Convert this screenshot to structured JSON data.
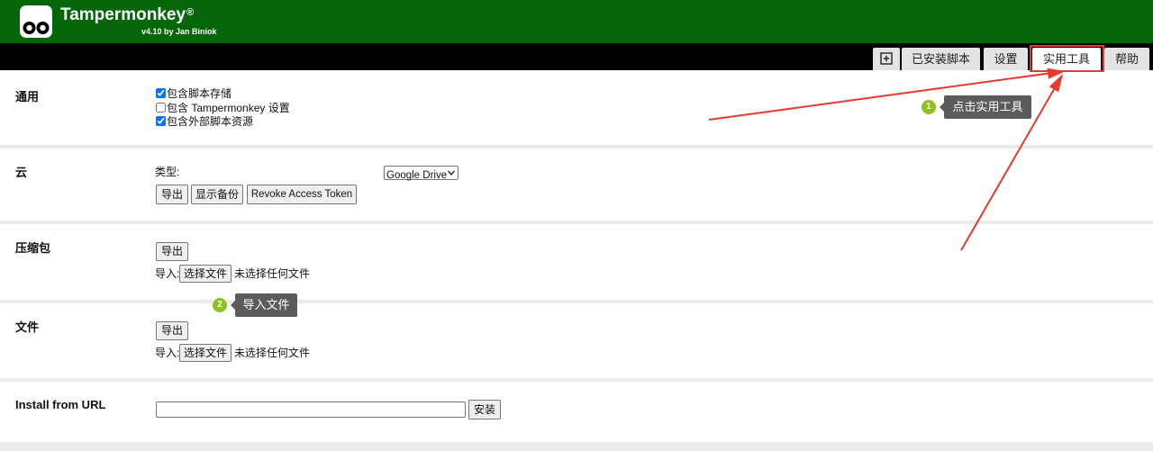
{
  "app": {
    "name": "Tampermonkey",
    "registered_mark": "®",
    "version_line": "v4.10 by Jan Biniok"
  },
  "tabs": {
    "new_script_icon": "plus-square-icon",
    "items": [
      {
        "label": "已安装脚本",
        "active": false
      },
      {
        "label": "设置",
        "active": false
      },
      {
        "label": "实用工具",
        "active": true
      },
      {
        "label": "帮助",
        "active": false
      }
    ]
  },
  "sections": {
    "general": {
      "title": "通用",
      "options": [
        {
          "label": "包含脚本存储",
          "checked": true
        },
        {
          "label": "包含 Tampermonkey 设置",
          "checked": false
        },
        {
          "label": "包含外部脚本资源",
          "checked": true
        }
      ]
    },
    "cloud": {
      "title": "云",
      "type_label": "类型:",
      "type_selected": "Google Drive",
      "export_label": "导出",
      "show_backup_label": "显示备份",
      "revoke_label": "Revoke Access Token"
    },
    "archive": {
      "title": "压缩包",
      "export_label": "导出",
      "import_label": "导入:",
      "choose_file_label": "选择文件",
      "no_file_text": "未选择任何文件"
    },
    "file": {
      "title": "文件",
      "export_label": "导出",
      "import_label": "导入:",
      "choose_file_label": "选择文件",
      "no_file_text": "未选择任何文件"
    },
    "install_url": {
      "title": "Install from URL",
      "url_value": "",
      "install_label": "安装"
    }
  },
  "annotations": [
    {
      "number": "1",
      "text": "点击实用工具"
    },
    {
      "number": "2",
      "text": "导入文件"
    }
  ],
  "icons": {
    "logo": "tampermonkey-logo",
    "new_script_tab": "plus-square-icon",
    "type_dropdown": "chevron-down-icon"
  },
  "colors": {
    "header_green": "#05670a",
    "tab_bar": "#000000",
    "annotation_red": "#e8392f",
    "badge_green": "#8dc21f",
    "tooltip_bg": "#5b5b5b",
    "separator": "#ebebeb"
  }
}
